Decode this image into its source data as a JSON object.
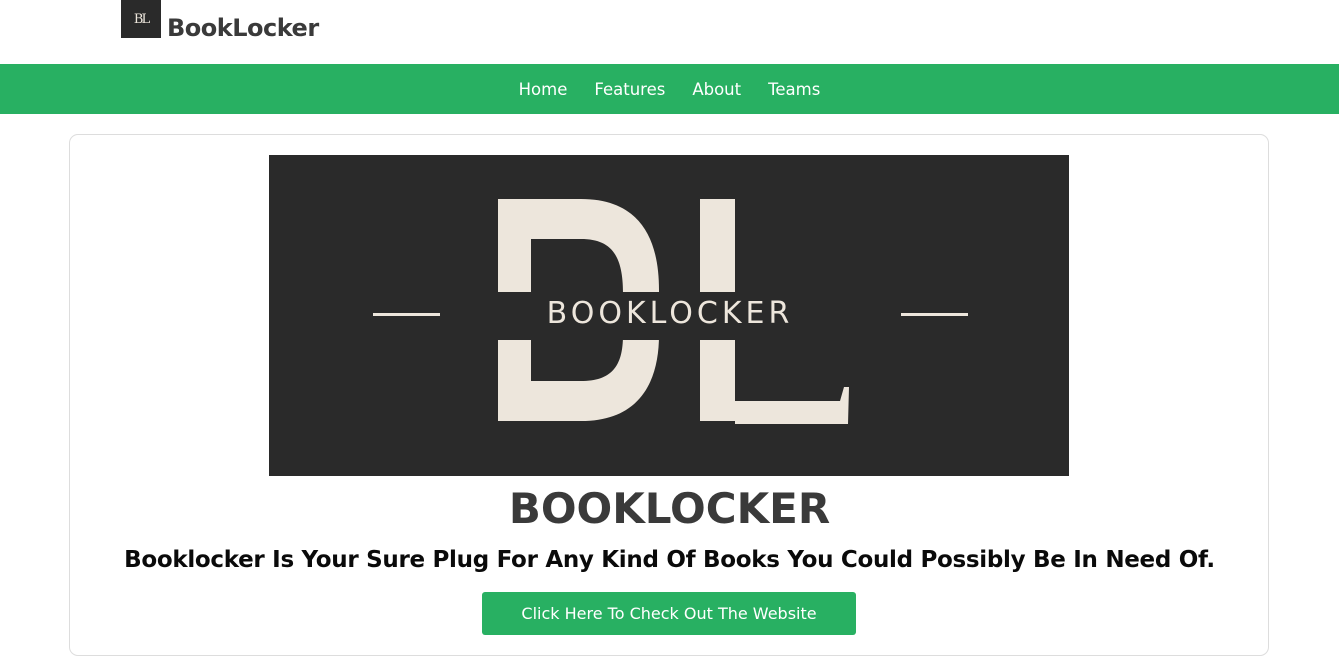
{
  "header": {
    "logo_text": "BL",
    "brand": "BookLocker"
  },
  "nav": {
    "items": [
      {
        "label": "Home"
      },
      {
        "label": "Features"
      },
      {
        "label": "About"
      },
      {
        "label": "Teams"
      }
    ]
  },
  "hero": {
    "logo_letters": "BL",
    "logo_wordmark": "BOOKLOCKER"
  },
  "main": {
    "title": "BOOKLOCKER",
    "tagline": "Booklocker Is Your Sure Plug For Any Kind Of Books You Could Possibly Be In Need Of.",
    "cta_label": "Click Here To Check Out The Website"
  },
  "colors": {
    "brand_green": "#28b062",
    "hero_bg": "#2a2a2a",
    "hero_cream": "#ede6dc"
  }
}
